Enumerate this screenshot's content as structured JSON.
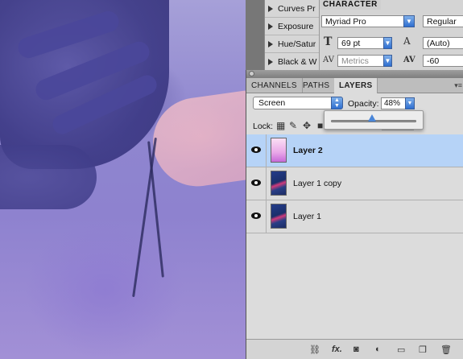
{
  "adjustments": {
    "items": [
      {
        "label": "Curves Pr"
      },
      {
        "label": "Exposure"
      },
      {
        "label": "Hue/Satur"
      },
      {
        "label": "Black & W"
      }
    ]
  },
  "character": {
    "tab_label": "CHARACTER",
    "font_family": "Myriad Pro",
    "font_style": "Regular",
    "font_size": "69 pt",
    "leading": "(Auto)",
    "kerning": "Metrics",
    "tracking": "-60"
  },
  "layers_panel": {
    "tabs": [
      {
        "label": "CHANNELS",
        "active": false
      },
      {
        "label": "PATHS",
        "active": false
      },
      {
        "label": "LAYERS",
        "active": true
      }
    ],
    "blend_mode": "Screen",
    "opacity_label": "Opacity:",
    "opacity_value": "48%",
    "opacity_slider_fraction": 0.48,
    "lock_label": "Lock:",
    "layers": [
      {
        "name": "Layer 2",
        "selected": true,
        "thumb": "pink-gradient"
      },
      {
        "name": "Layer 1 copy",
        "selected": false,
        "thumb": "photo"
      },
      {
        "name": "Layer 1",
        "selected": false,
        "thumb": "photo"
      }
    ]
  },
  "icons": {
    "visibility": "eye-icon",
    "lock_transparent": "checkerboard-icon",
    "lock_image": "brush-icon",
    "lock_position": "move-icon",
    "lock_all": "lock-icon",
    "bottom": [
      "link-icon",
      "fx-icon",
      "mask-icon",
      "adjustment-icon",
      "folder-icon",
      "new-layer-icon",
      "trash-icon"
    ]
  },
  "colors": {
    "selected_row": "#b6d3f7",
    "accent": "#2f6fd0"
  }
}
